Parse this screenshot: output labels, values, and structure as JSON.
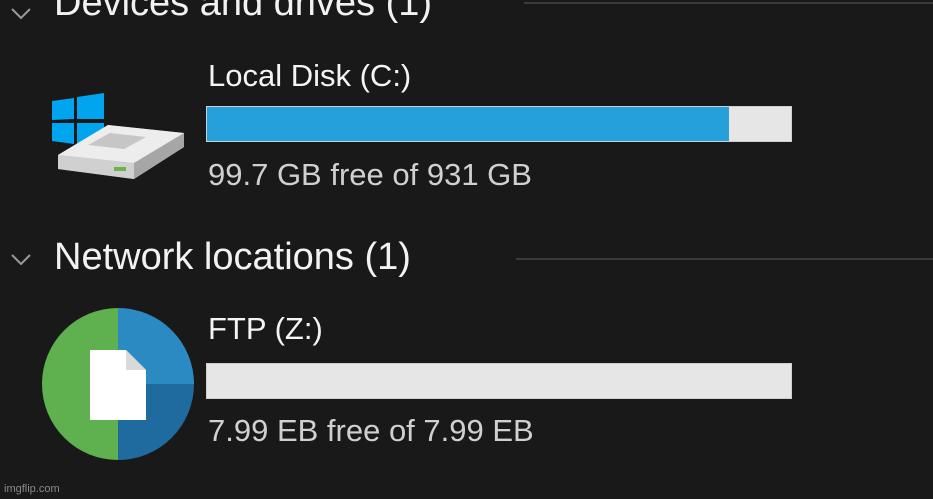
{
  "groups": [
    {
      "title": "Devices and drives (1)",
      "drives": [
        {
          "name": "Local Disk (C:)",
          "free_text": "99.7 GB free of 931 GB",
          "used_fraction": 0.893,
          "icon": "windows-hard-drive-icon"
        }
      ]
    },
    {
      "title": "Network locations (1)",
      "drives": [
        {
          "name": "FTP (Z:)",
          "free_text": "7.99 EB free of 7.99 EB",
          "used_fraction": 0,
          "icon": "network-drive-icon"
        }
      ]
    }
  ],
  "colors": {
    "background": "#191919",
    "bar_fill": "#26a0da",
    "bar_track": "#e6e6e6",
    "windows_logo": "#00a4ef"
  },
  "watermark": "imgflip.com"
}
